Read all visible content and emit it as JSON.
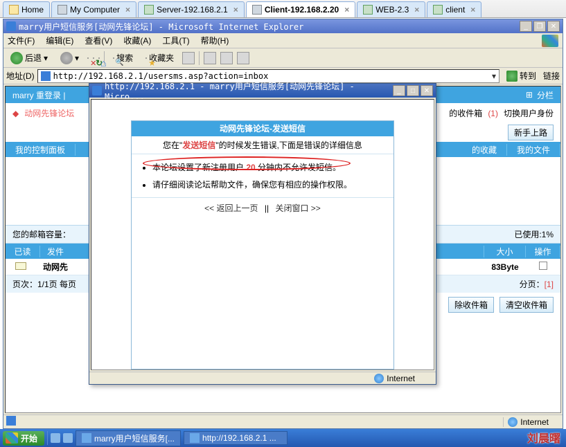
{
  "vm_tabs": [
    {
      "label": "Home",
      "icon": "home",
      "closable": false
    },
    {
      "label": "My Computer",
      "icon": "pc",
      "closable": true
    },
    {
      "label": "Server-192.168.2.1",
      "icon": "server",
      "closable": true
    },
    {
      "label": "Client-192.168.2.20",
      "icon": "pc",
      "closable": true,
      "active": true
    },
    {
      "label": "WEB-2.3",
      "icon": "server",
      "closable": true
    },
    {
      "label": "client",
      "icon": "server",
      "closable": true
    }
  ],
  "ie_main": {
    "title": "marry用户短信服务[动网先锋论坛] - Microsoft Internet Explorer",
    "menu": [
      "文件(F)",
      "编辑(E)",
      "查看(V)",
      "收藏(A)",
      "工具(T)",
      "帮助(H)"
    ],
    "toolbar": {
      "back": "后退",
      "search": "搜索",
      "favorites": "收藏夹"
    },
    "address": {
      "label": "地址(D)",
      "url": "http://192.168.2.1/usersms.asp?action=inbox",
      "go": "转到",
      "links": "链接"
    },
    "status_zone": "Internet"
  },
  "page": {
    "header": {
      "login": "marry 重登录 |",
      "split": "分栏"
    },
    "breadcrumb": {
      "forum": "动网先锋论坛",
      "inbox_suffix": "的收件箱",
      "count": "(1)",
      "switch_id": "切换用户身份"
    },
    "newbie_btn": "新手上路",
    "nav": {
      "control_panel": "我的控制面板",
      "favorites": "的收藏",
      "files": "我的文件"
    },
    "mailbox": {
      "left": "您的邮箱容量：",
      "right": "已使用:1%"
    },
    "table": {
      "headers": {
        "read": "已读",
        "from": "发件",
        "size": "大小",
        "op": "操作"
      },
      "row": {
        "from_prefix": "动网先",
        "size": "83Byte"
      }
    },
    "pager": {
      "left": "页次：1/1页 每页",
      "right_label": "分页：",
      "right_num": "[1]"
    },
    "buttons": {
      "del_sel": "除收件箱",
      "clear": "清空收件箱"
    }
  },
  "popup": {
    "title": "http://192.168.2.1 - marry用户短信服务[动网先锋论坛] - Micro...",
    "box_title": "动网先锋论坛-发送短信",
    "sub_prefix": "您在\"",
    "sub_action": "发送短信",
    "sub_suffix": "\"的时候发生错误,下面是错误的详细信息",
    "item1_pre": "本论坛设置了新注册用户 ",
    "item1_num": "20",
    "item1_post": " 分钟内不允许发短信。",
    "item2": "请仔细阅读论坛帮助文件，确保您有相应的操作权限。",
    "footer_back": "<< 返回上一页",
    "footer_sep": "||",
    "footer_close": "关闭窗口 >>",
    "status_zone": "Internet"
  },
  "taskbar": {
    "start": "开始",
    "task1": "marry用户短信服务[...",
    "task2": "http://192.168.2.1 ..."
  },
  "watermark": "刘晨曙"
}
